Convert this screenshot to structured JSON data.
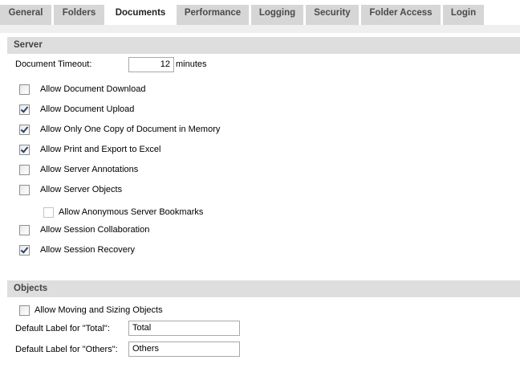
{
  "tabs": [
    {
      "label": "General"
    },
    {
      "label": "Folders"
    },
    {
      "label": "Documents"
    },
    {
      "label": "Performance"
    },
    {
      "label": "Logging"
    },
    {
      "label": "Security"
    },
    {
      "label": "Folder Access"
    },
    {
      "label": "Login"
    }
  ],
  "active_tab": "Documents",
  "server": {
    "header": "Server",
    "timeout_label": "Document Timeout:",
    "timeout_value": "12",
    "timeout_unit": "minutes",
    "options": [
      {
        "label": "Allow Document Download",
        "checked": false
      },
      {
        "label": "Allow Document Upload",
        "checked": true
      },
      {
        "label": "Allow Only One Copy of Document in Memory",
        "checked": true
      },
      {
        "label": "Allow Print and Export to Excel",
        "checked": true
      },
      {
        "label": "Allow Server Annotations",
        "checked": false
      },
      {
        "label": "Allow Server Objects",
        "checked": false
      },
      {
        "label": "Allow Anonymous Server Bookmarks",
        "checked": false,
        "disabled": true
      },
      {
        "label": "Allow Session Collaboration",
        "checked": false
      },
      {
        "label": "Allow Session Recovery",
        "checked": true
      }
    ]
  },
  "objects": {
    "header": "Objects",
    "moving_sizing": {
      "label": "Allow Moving and Sizing Objects",
      "checked": false
    },
    "total_label": "Default Label for \"Total\":",
    "total_value": "Total",
    "others_label": "Default Label for \"Others\":",
    "others_value": "Others"
  }
}
